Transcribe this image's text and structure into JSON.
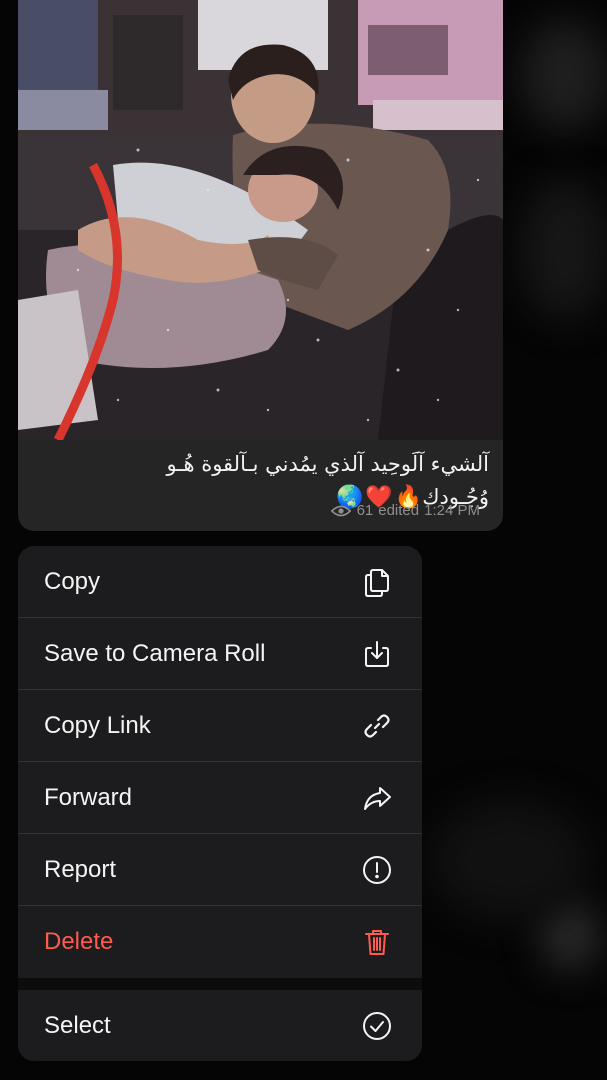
{
  "message": {
    "caption_line1": "آلشيء آلَوحِيد آلذي يمُدني بـآلقوة هُـو",
    "caption_line2": "وُجُـودك",
    "caption_emojis": [
      "🔥",
      "❤️",
      "🌏"
    ],
    "views": "61",
    "edited_label": "edited",
    "time": "1:24 PM"
  },
  "menu": {
    "items": [
      {
        "label": "Copy",
        "icon": "copy-icon"
      },
      {
        "label": "Save to Camera Roll",
        "icon": "download-icon"
      },
      {
        "label": "Copy Link",
        "icon": "link-icon"
      },
      {
        "label": "Forward",
        "icon": "forward-icon"
      },
      {
        "label": "Report",
        "icon": "report-icon"
      },
      {
        "label": "Delete",
        "icon": "trash-icon",
        "color": "#ff5a4e"
      }
    ],
    "select_item": {
      "label": "Select",
      "icon": "check-circle-icon"
    }
  }
}
